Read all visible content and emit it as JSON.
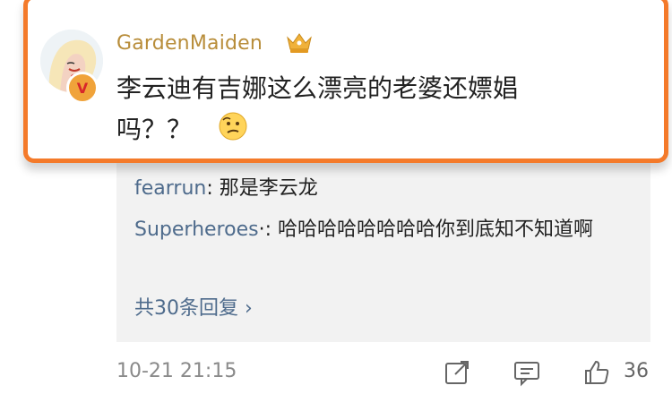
{
  "comment": {
    "username": "GardenMaiden",
    "text": "李云迪有吉娜这么漂亮的老婆还嫖娼吗？？",
    "emoji": "thinking-emoji",
    "accent_color": "#f47a2a"
  },
  "replies": [
    {
      "name": "fearrun",
      "text": ": 那是李云龙"
    },
    {
      "name": "Superheroes",
      "text": "·: 哈哈哈哈哈哈哈哈你到底知不知道啊"
    }
  ],
  "more_replies": "共30条回复 ›",
  "footer": {
    "date": "10-21 21:15",
    "likes": "36"
  }
}
